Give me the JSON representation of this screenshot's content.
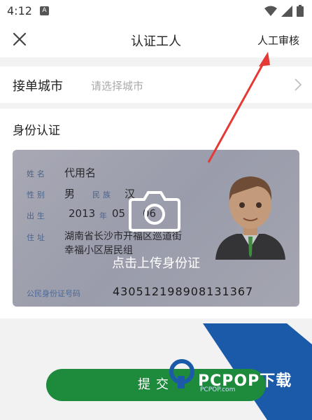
{
  "status_bar": {
    "time": "4:12",
    "notif_icon": "A"
  },
  "header": {
    "title": "认证工人",
    "right_action": "人工审核"
  },
  "city": {
    "label": "接单城市",
    "placeholder": "请选择城市"
  },
  "id_section": {
    "title": "身份认证",
    "card": {
      "labels": {
        "name": "姓名",
        "gender": "性别",
        "ethnicity": "民族",
        "birth": "出生",
        "year": "年",
        "address": "住址",
        "id_number": "公民身份证号码"
      },
      "name": "代用名",
      "gender": "男",
      "ethnicity": "汉",
      "birth_year": "2013",
      "birth_month": "05",
      "birth_day": "06",
      "address_line1": "湖南省长沙市开福区巡道街",
      "address_line2": "幸福小区居民组",
      "id_number": "430512198908131367"
    },
    "upload_prompt": "点击上传身份证"
  },
  "submit_label": "提交",
  "watermark": {
    "brand": "PCPOP下载",
    "sub": "PCPOP.com"
  },
  "colors": {
    "accent_green": "#1e8a3c",
    "arrow_red": "#e53935",
    "watermark_blue": "#1a5aa8"
  },
  "icons": [
    "close-icon",
    "chevron-right-icon",
    "camera-icon",
    "wifi-icon",
    "signal-icon",
    "battery-icon"
  ]
}
